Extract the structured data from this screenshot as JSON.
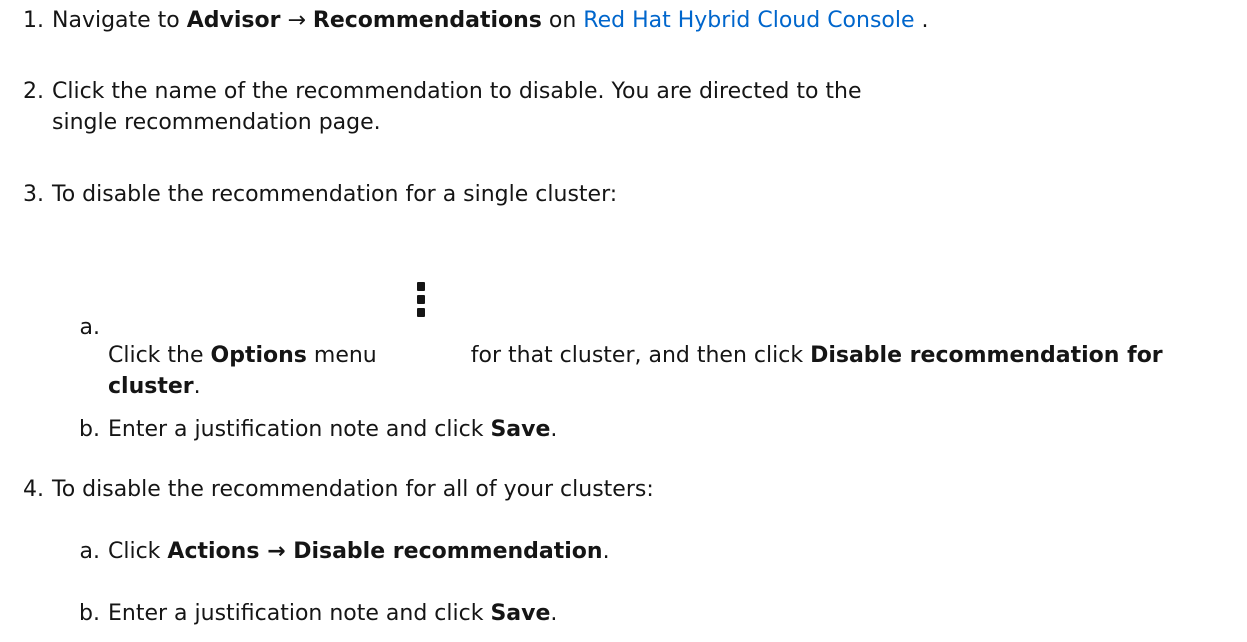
{
  "steps": [
    {
      "number": "1.",
      "prefix": "Navigate to ",
      "advisor": "Advisor",
      "arrow": "→",
      "recommendations": "Recommendations",
      "on": " on ",
      "link_text": "Red Hat Hybrid Cloud Console",
      "suffix": " ."
    },
    {
      "number": "2.",
      "text": "Click the name of the recommendation to disable. You are directed to the single recommendation page."
    },
    {
      "number": "3.",
      "text": "To disable the recommendation for a single cluster:",
      "substeps": [
        {
          "letter": "a.",
          "prefix": "Click the ",
          "options": "Options",
          "menu": " menu",
          "icon": "kebab-menu-icon",
          "middle": "for that cluster, and then click ",
          "disable": "Disable recommendation for cluster",
          "suffix": "."
        },
        {
          "letter": "b.",
          "prefix": "Enter a justification note and click ",
          "save": "Save",
          "suffix": "."
        }
      ]
    },
    {
      "number": "4.",
      "text": "To disable the recommendation for all of your clusters:",
      "substeps": [
        {
          "letter": "a.",
          "prefix": "Click ",
          "actions": "Actions",
          "arrow": " → ",
          "disable": "Disable recommendation",
          "suffix": "."
        },
        {
          "letter": "b.",
          "prefix": "Enter a justification note and click ",
          "save": "Save",
          "suffix": "."
        }
      ]
    }
  ],
  "colors": {
    "text": "#151515",
    "link": "#0066cc"
  }
}
